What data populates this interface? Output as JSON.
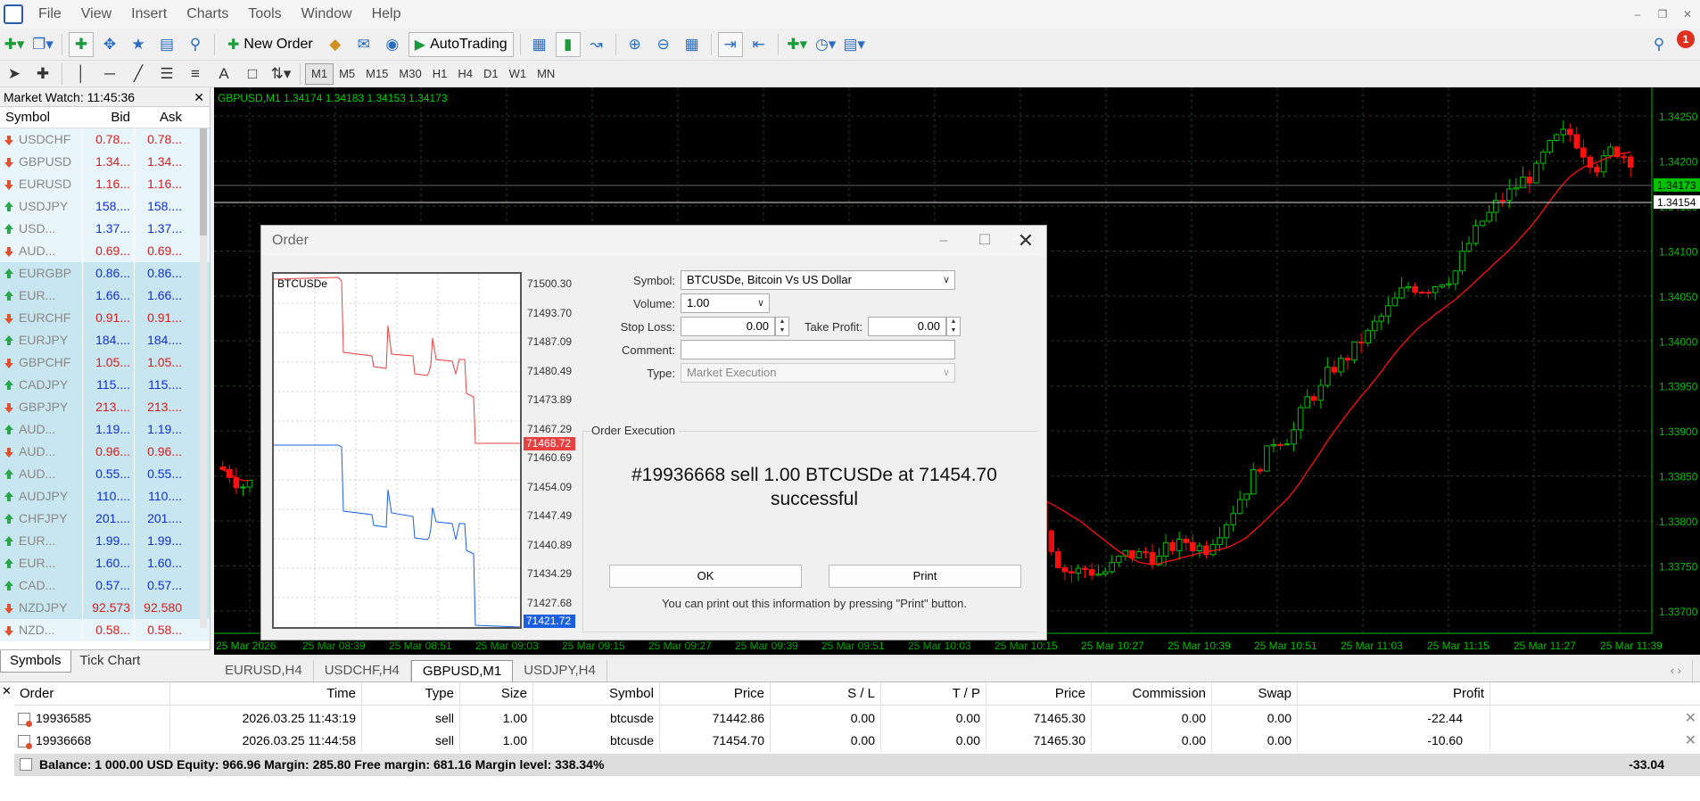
{
  "menu": {
    "items": [
      "File",
      "View",
      "Insert",
      "Charts",
      "Tools",
      "Window",
      "Help"
    ]
  },
  "toolbar": {
    "new_order": "New Order",
    "autotrading": "AutoTrading",
    "timeframes": [
      "M1",
      "M5",
      "M15",
      "M30",
      "H1",
      "H4",
      "D1",
      "W1",
      "MN"
    ],
    "active_tf": "M1",
    "badge": "1"
  },
  "market_watch": {
    "title": "Market Watch: 11:45:36",
    "headers": {
      "symbol": "Symbol",
      "bid": "Bid",
      "ask": "Ask"
    },
    "rows": [
      {
        "symbol": "USDCHF",
        "bid": "0.78...",
        "ask": "0.78...",
        "dir": "dn"
      },
      {
        "symbol": "GBPUSD",
        "bid": "1.34...",
        "ask": "1.34...",
        "dir": "dn"
      },
      {
        "symbol": "EURUSD",
        "bid": "1.16...",
        "ask": "1.16...",
        "dir": "dn"
      },
      {
        "symbol": "USDJPY",
        "bid": "158....",
        "ask": "158....",
        "dir": "up"
      },
      {
        "symbol": "USD...",
        "bid": "1.37...",
        "ask": "1.37...",
        "dir": "up"
      },
      {
        "symbol": "AUD...",
        "bid": "0.69...",
        "ask": "0.69...",
        "dir": "dn"
      },
      {
        "symbol": "EURGBP",
        "bid": "0.86...",
        "ask": "0.86...",
        "dir": "up"
      },
      {
        "symbol": "EUR...",
        "bid": "1.66...",
        "ask": "1.66...",
        "dir": "up"
      },
      {
        "symbol": "EURCHF",
        "bid": "0.91...",
        "ask": "0.91...",
        "dir": "dn"
      },
      {
        "symbol": "EURJPY",
        "bid": "184....",
        "ask": "184....",
        "dir": "up"
      },
      {
        "symbol": "GBPCHF",
        "bid": "1.05...",
        "ask": "1.05...",
        "dir": "dn"
      },
      {
        "symbol": "CADJPY",
        "bid": "115....",
        "ask": "115....",
        "dir": "up"
      },
      {
        "symbol": "GBPJPY",
        "bid": "213....",
        "ask": "213....",
        "dir": "dn"
      },
      {
        "symbol": "AUD...",
        "bid": "1.19...",
        "ask": "1.19...",
        "dir": "up"
      },
      {
        "symbol": "AUD...",
        "bid": "0.96...",
        "ask": "0.96...",
        "dir": "dn"
      },
      {
        "symbol": "AUD...",
        "bid": "0.55...",
        "ask": "0.55...",
        "dir": "up"
      },
      {
        "symbol": "AUDJPY",
        "bid": "110....",
        "ask": "110....",
        "dir": "up"
      },
      {
        "symbol": "CHFJPY",
        "bid": "201....",
        "ask": "201....",
        "dir": "up"
      },
      {
        "symbol": "EUR...",
        "bid": "1.99...",
        "ask": "1.99...",
        "dir": "up"
      },
      {
        "symbol": "EUR...",
        "bid": "1.60...",
        "ask": "1.60...",
        "dir": "up"
      },
      {
        "symbol": "CAD...",
        "bid": "0.57...",
        "ask": "0.57...",
        "dir": "up"
      },
      {
        "symbol": "NZDJPY",
        "bid": "92.573",
        "ask": "92.580",
        "dir": "dn"
      },
      {
        "symbol": "NZD...",
        "bid": "0.58...",
        "ask": "0.58...",
        "dir": "dn"
      }
    ],
    "tabs": [
      "Symbols",
      "Tick Chart"
    ],
    "active_tab": "Symbols"
  },
  "chart": {
    "header": "GBPUSD,M1  1.34174 1.34183 1.34153 1.34173",
    "price_labels": [
      "1.34250",
      "1.34200",
      "1.34150",
      "1.34100",
      "1.34050",
      "1.34000",
      "1.33950",
      "1.33900",
      "1.33850",
      "1.33800",
      "1.33750",
      "1.33700"
    ],
    "price_values": [
      1.3425,
      1.342,
      1.3415,
      1.341,
      1.3405,
      1.34,
      1.3395,
      1.339,
      1.3385,
      1.338,
      1.3375,
      1.337
    ],
    "bid_tag": "1.34173",
    "bid_value": 1.34173,
    "line_tag": "1.34154",
    "line_value": 1.34154,
    "time_labels": [
      "25 Mar 2026",
      "25 Mar 08:39",
      "25 Mar 08:51",
      "25 Mar 09:03",
      "25 Mar 09:15",
      "25 Mar 09:27",
      "25 Mar 09:39",
      "25 Mar 09:51",
      "25 Mar 10:03",
      "25 Mar 10:15",
      "25 Mar 10:27",
      "25 Mar 10:39",
      "25 Mar 10:51",
      "25 Mar 11:03",
      "25 Mar 11:15",
      "25 Mar 11:27",
      "25 Mar 11:39"
    ],
    "colors": {
      "bull": "#00c000",
      "bear": "#ff1010",
      "ma": "#ff1010",
      "grid": "#1d3a1d",
      "axis": "#00c000"
    },
    "tabs": [
      "EURUSD,H4",
      "USDCHF,H4",
      "GBPUSD,M1",
      "USDJPY,H4"
    ],
    "active_tab": "GBPUSD,M1"
  },
  "order_dialog": {
    "title": "Order",
    "mini_chart": {
      "symbol": "BTCUSDe",
      "prices": [
        "71500.30",
        "71493.70",
        "71487.09",
        "71480.49",
        "71473.89",
        "71467.29",
        "71460.69",
        "71454.09",
        "71447.49",
        "71440.89",
        "71434.29",
        "71427.68"
      ],
      "bid_tag": "71468.72",
      "ask_tag": "71421.72",
      "colors": {
        "bid": "#e84040",
        "ask": "#1a60e0"
      }
    },
    "symbol_label": "Symbol:",
    "symbol_value": "BTCUSDe, Bitcoin Vs US Dollar",
    "volume_label": "Volume:",
    "volume_value": "1.00",
    "stoploss_label": "Stop Loss:",
    "stoploss_value": "0.00",
    "takeprofit_label": "Take Profit:",
    "takeprofit_value": "0.00",
    "comment_label": "Comment:",
    "comment_value": "",
    "type_label": "Type:",
    "type_value": "Market Execution",
    "execution_legend": "Order Execution",
    "execution_message_1": "#19936668 sell 1.00 BTCUSDe at 71454.70",
    "execution_message_2": "successful",
    "ok_label": "OK",
    "print_label": "Print",
    "note": "You can print out this information by pressing \"Print\" button."
  },
  "terminal": {
    "headers": [
      "Order",
      "Time",
      "Type",
      "Size",
      "Symbol",
      "Price",
      "S / L",
      "T / P",
      "Price",
      "Commission",
      "Swap",
      "Profit"
    ],
    "rows": [
      [
        "19936585",
        "2026.03.25 11:43:19",
        "sell",
        "1.00",
        "btcusde",
        "71442.86",
        "0.00",
        "0.00",
        "71465.30",
        "0.00",
        "0.00",
        "-22.44"
      ],
      [
        "19936668",
        "2026.03.25 11:44:58",
        "sell",
        "1.00",
        "btcusde",
        "71454.70",
        "0.00",
        "0.00",
        "71465.30",
        "0.00",
        "0.00",
        "-10.60"
      ]
    ],
    "balance": "Balance: 1 000.00 USD  Equity: 966.96  Margin: 285.80  Free margin: 681.16  Margin level: 338.34%",
    "total": "-33.04"
  }
}
